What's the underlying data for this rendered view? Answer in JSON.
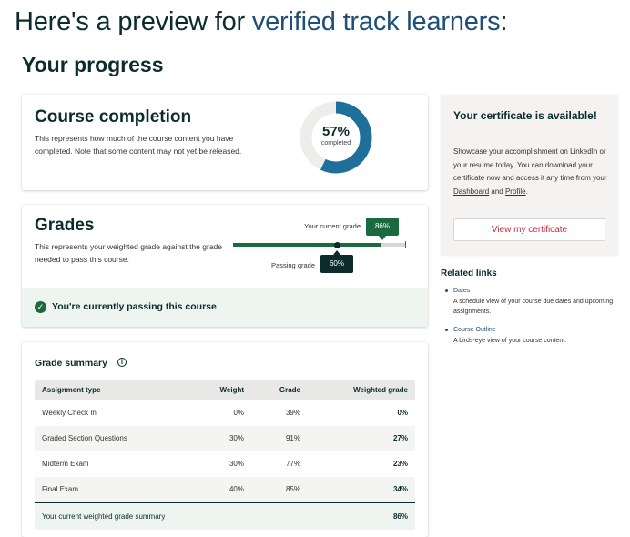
{
  "headline": {
    "prefix": "Here's a preview for ",
    "accent": "verified track learners",
    "suffix": ":"
  },
  "progress_title": "Your progress",
  "completion": {
    "title": "Course completion",
    "description": "This represents how much of the course content you have completed. Note that some content may not yet be released.",
    "percent_label": "57%",
    "percent_value": 57,
    "caption": "completed",
    "colors": {
      "completed": "#1f6f9b",
      "remaining": "#ededeb"
    }
  },
  "grades": {
    "title": "Grades",
    "description": "This represents your weighted grade against the grade needed to pass this course.",
    "current_label": "Your current grade",
    "current_value": "86%",
    "current_fraction": 0.86,
    "passing_label": "Passing grade",
    "passing_value": "60%",
    "passing_fraction": 0.6,
    "status": "You're currently passing this course",
    "colors": {
      "fill": "#1b6a3f",
      "passing": "#0b2b2c"
    }
  },
  "summary": {
    "title": "Grade summary",
    "columns": [
      "Assignment type",
      "Weight",
      "Grade",
      "Weighted grade"
    ],
    "rows": [
      [
        "Weekly Check In",
        "0%",
        "39%",
        "0%"
      ],
      [
        "Graded Section Questions",
        "30%",
        "91%",
        "27%"
      ],
      [
        "Midterm Exam",
        "30%",
        "77%",
        "23%"
      ],
      [
        "Final Exam",
        "40%",
        "85%",
        "34%"
      ]
    ],
    "footer": {
      "label": "Your current weighted grade summary",
      "value": "86%"
    }
  },
  "certificate": {
    "title": "Your certificate is available!",
    "desc_part1": "Showcase your accomplishment on LinkedIn or your resume today. You can download your certificate now and access it any time from your ",
    "dashboard_link": "Dashboard",
    "desc_and": " and ",
    "profile_link": "Profile",
    "desc_end": ".",
    "button": "View my certificate"
  },
  "related": {
    "title": "Related links",
    "items": [
      {
        "link": "Dates",
        "text": "A schedule view of your course due dates and upcoming assignments."
      },
      {
        "link": "Course Outline",
        "text": "A birds-eye view of your course content."
      }
    ]
  }
}
